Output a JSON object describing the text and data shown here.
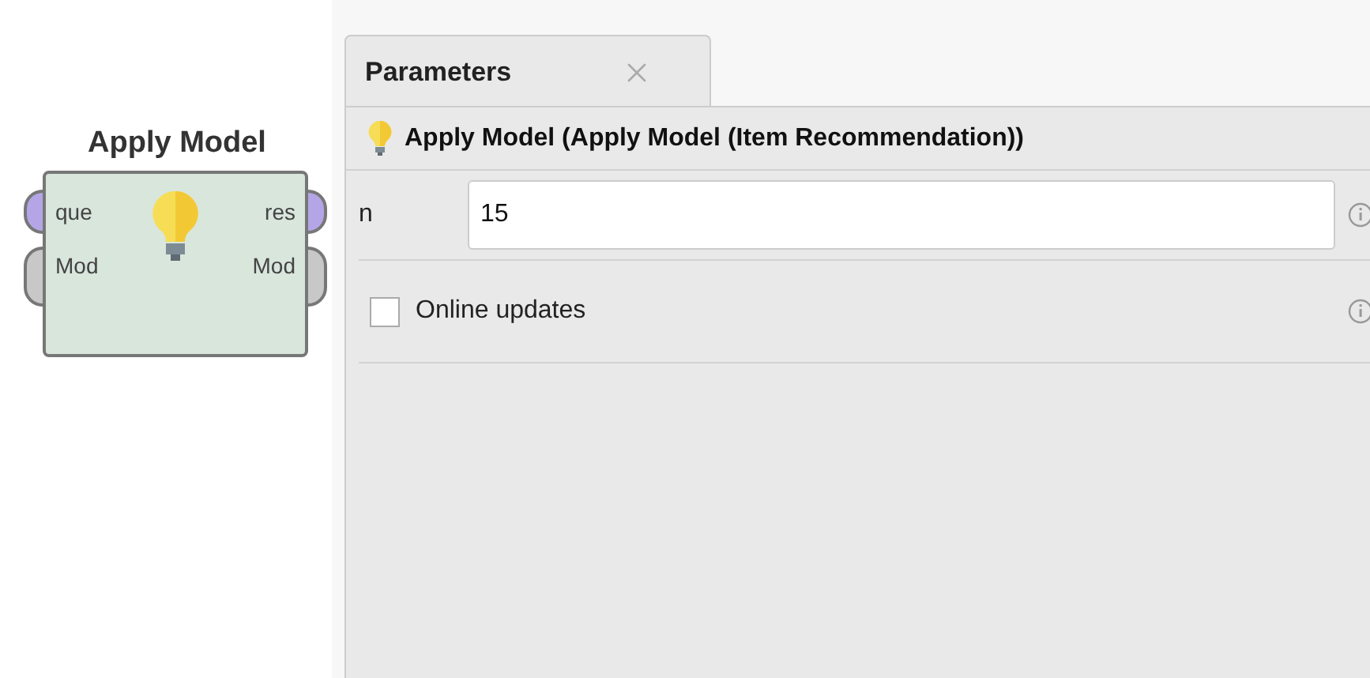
{
  "operator": {
    "title": "Apply Model",
    "inputs": [
      {
        "label": "que",
        "color": "#b4a6e6"
      },
      {
        "label": "Mod",
        "color": "#c8c8c8"
      }
    ],
    "outputs": [
      {
        "label": "res",
        "color": "#b4a6e6"
      },
      {
        "label": "Mod",
        "color": "#c8c8c8"
      }
    ]
  },
  "panel": {
    "tabs": [
      {
        "label": "Parameters",
        "selected": true
      }
    ],
    "header": "Apply Model (Apply Model (Item Recommendation))",
    "parameters": [
      {
        "kind": "text",
        "label": "n",
        "value": "15"
      },
      {
        "kind": "checkbox",
        "label": "Online updates",
        "checked": false
      }
    ]
  }
}
